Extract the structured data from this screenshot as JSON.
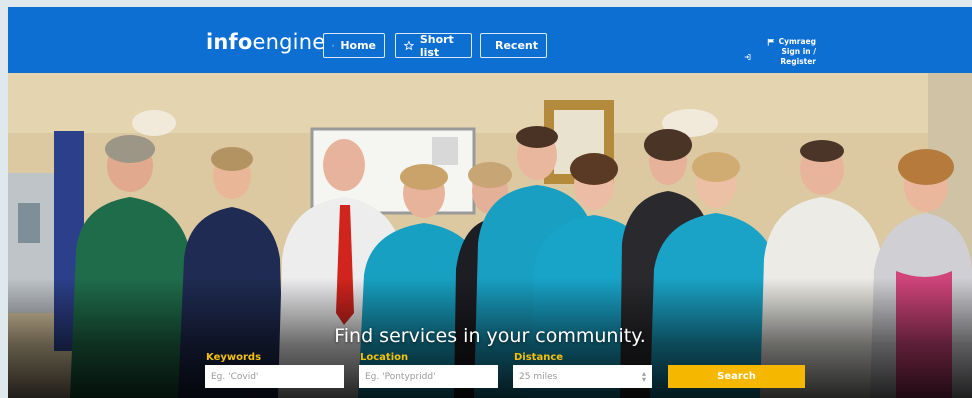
{
  "header": {
    "logo_bold": "info",
    "logo_regular": "engine",
    "nav": [
      {
        "label": "Home",
        "icon": "home-icon"
      },
      {
        "label": "Short list",
        "icon": "star-icon"
      },
      {
        "label": "Recent",
        "icon": "clock-icon"
      }
    ],
    "language_link": "Cymraeg",
    "signin_link": "Sign in / Register"
  },
  "hero": {
    "tagline": "Find services in your community.",
    "keywords": {
      "label": "Keywords",
      "placeholder": "Eg. 'Covid'"
    },
    "location": {
      "label": "Location",
      "placeholder": "Eg. 'Pontypridd'"
    },
    "distance": {
      "label": "Distance",
      "value": "25 miles"
    },
    "search_label": "Search"
  },
  "colors": {
    "header_blue": "#0e6fd3",
    "accent_yellow": "#f5b700",
    "label_yellow": "#f4c20d"
  }
}
